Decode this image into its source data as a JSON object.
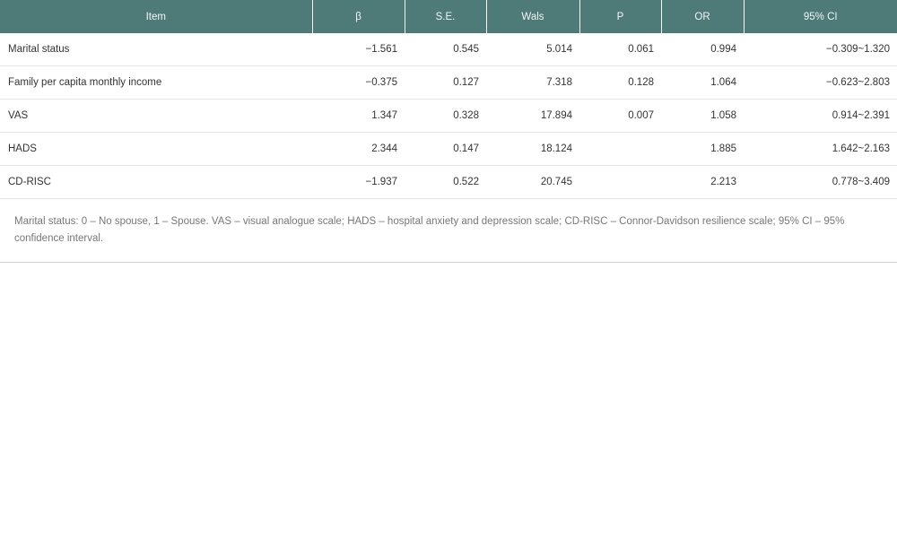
{
  "table": {
    "headers": [
      "Item",
      "β",
      "S.E.",
      "Wals",
      "P",
      "OR",
      "95% CI"
    ],
    "rows": [
      [
        "Marital status",
        "−1.561",
        "0.545",
        "5.014",
        "0.061",
        "0.994",
        "−0.309~1.320"
      ],
      [
        "Family per capita monthly income",
        "−0.375",
        "0.127",
        "7.318",
        "0.128",
        "1.064",
        "−0.623~2.803"
      ],
      [
        "VAS",
        "1.347",
        "0.328",
        "17.894",
        "0.007",
        "1.058",
        "0.914~2.391"
      ],
      [
        "HADS",
        "2.344",
        "0.147",
        "18.124",
        "",
        "1.885",
        "1.642~2.163"
      ],
      [
        "CD-RISC",
        "−1.937",
        "0.522",
        "20.745",
        "",
        "2.213",
        "0.778~3.409"
      ]
    ],
    "footnote": "Marital status: 0 – No spouse, 1 – Spouse. VAS – visual analogue scale; HADS – hospital anxiety and depression scale; CD-RISC – Connor-Davidson resilience scale; 95% CI – 95% confidence interval."
  },
  "colors": {
    "header_bg": "#4e7a78",
    "header_text": "#f2f6f5"
  }
}
